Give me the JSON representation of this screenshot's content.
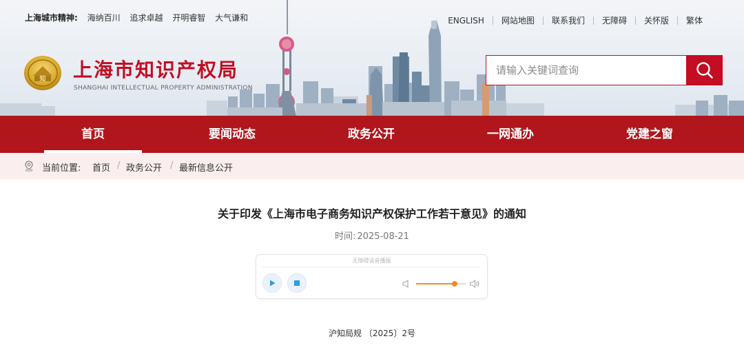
{
  "header": {
    "motto_label": "上海城市精神:",
    "motto_items": [
      "海纳百川",
      "追求卓越",
      "开明睿智",
      "大气谦和"
    ],
    "top_links": [
      "ENGLISH",
      "网站地图",
      "联系我们",
      "无障碍",
      "关怀版",
      "繁体"
    ],
    "emblem_text": "知",
    "site_title": "上海市知识产权局",
    "site_subtitle": "SHANGHAI INTELLECTUAL PROPERTY ADMINISTRATION",
    "search_placeholder": "请输入关键词查询",
    "search_value": ""
  },
  "nav": {
    "items": [
      "首页",
      "要闻动态",
      "政务公开",
      "一网通办",
      "党建之窗"
    ],
    "active_index": 0
  },
  "breadcrumb": {
    "label": "当前位置:",
    "items": [
      "首页",
      "政务公开",
      "最新信息公开"
    ],
    "separator": "/"
  },
  "article": {
    "title": "关于印发《上海市电子商务知识产权保护工作若干意见》的通知",
    "time_label": "时间:",
    "time_value": "2025-08-21",
    "doc_number": "沪知局规 〔2025〕2号"
  },
  "player": {
    "title": "无障碍语音播报",
    "volume": 0.78
  },
  "colors": {
    "brand_red": "#c30d23",
    "nav_red": "#b0161c",
    "crumb_bg": "#fbeeee",
    "volume_orange": "#f08a24",
    "player_icon_blue": "#2f9be8"
  }
}
